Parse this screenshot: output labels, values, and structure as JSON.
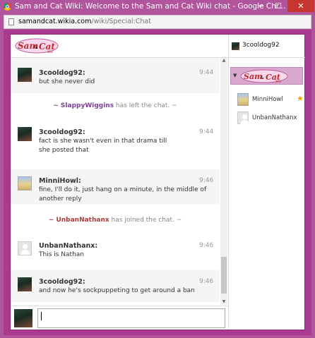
{
  "window": {
    "title": "Sam and Cat Wiki: Welcome to the Sam and Cat Wiki chat - Google Chr...",
    "controls": {
      "minimize": "─",
      "maximize": "☐",
      "close": "✕"
    }
  },
  "address": {
    "domain": "samandcat.wikia.com",
    "path": "/wiki/Special:Chat"
  },
  "logo": {
    "line1": "Sam",
    "line2": "Cat",
    "amp": "&",
    "sub": "Wiki"
  },
  "header": {
    "username": "3cooldog92"
  },
  "messages": [
    {
      "name": "3cooldog92:",
      "time": "9:44",
      "lines": [
        "but she never did"
      ]
    },
    {
      "inline": true,
      "who": "~ SlappyWiggins",
      "rest": " has left the chat. ~",
      "color": "#7a3e96"
    },
    {
      "name": "3cooldog92:",
      "time": "9:44",
      "lines": [
        "fact is she wasn't even in that drama till",
        "she posted that"
      ]
    },
    {
      "name": "MinniHowl:",
      "time": "9:46",
      "lines": [
        "fine, I'll do it, just hang on a minute, in the middle of",
        "another reply"
      ]
    },
    {
      "inline": true,
      "who": "~ UnbanNathanx",
      "rest": " has joined the chat. ~",
      "color": "#b03a3a"
    },
    {
      "name": "UnbanNathanx:",
      "time": "9:46",
      "lines": [
        "This is Nathan"
      ]
    },
    {
      "name": "3cooldog92:",
      "time": "9:46",
      "lines": [
        "and now he's sockpuppeting to get around a ban"
      ]
    }
  ],
  "userlist": {
    "room_arrow": "▼",
    "users": [
      {
        "name": "MinniHowl",
        "badge": "★"
      },
      {
        "name": "UnbanNathanx"
      }
    ]
  },
  "colors": {
    "frame": "#b0559c",
    "page_bg": "#aa3a8f",
    "close": "#c7372f",
    "star": "#f2a600"
  }
}
